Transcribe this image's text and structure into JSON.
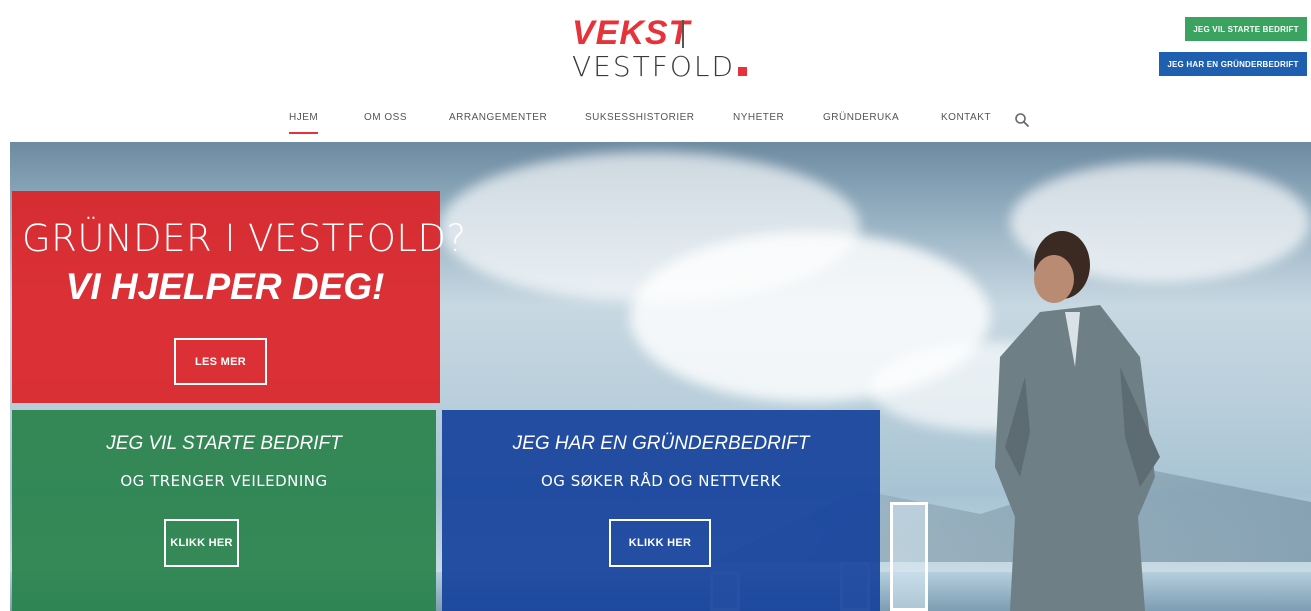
{
  "logo": {
    "line1": "VEKST",
    "line2": "VESTFOLD"
  },
  "top_ctas": {
    "start": "JEG VIL STARTE BEDRIFT",
    "have": "JEG HAR EN GRÜNDERBEDRIFT"
  },
  "nav": {
    "items": [
      {
        "label": "HJEM",
        "active": true
      },
      {
        "label": "OM OSS"
      },
      {
        "label": "ARRANGEMENTER"
      },
      {
        "label": "SUKSESSHISTORIER"
      },
      {
        "label": "NYHETER"
      },
      {
        "label": "GRÜNDERUKA"
      },
      {
        "label": "KONTAKT"
      }
    ],
    "search_icon": "search-icon"
  },
  "hero": {
    "title": "GRÜNDER I VESTFOLD?",
    "subtitle": "VI HJELPER DEG!",
    "cta": "LES MER"
  },
  "cards": {
    "start": {
      "title": "JEG VIL STARTE BEDRIFT",
      "subtitle": "OG TRENGER VEILEDNING",
      "button": "KLIKK HER"
    },
    "have": {
      "title": "JEG HAR EN GRÜNDERBEDRIFT",
      "subtitle": "OG SØKER RÅD OG NETTVERK",
      "button": "KLIKK HER"
    }
  },
  "colors": {
    "brand_red": "#e8323a",
    "green": "#3aa35f",
    "blue": "#1f5fb0"
  }
}
